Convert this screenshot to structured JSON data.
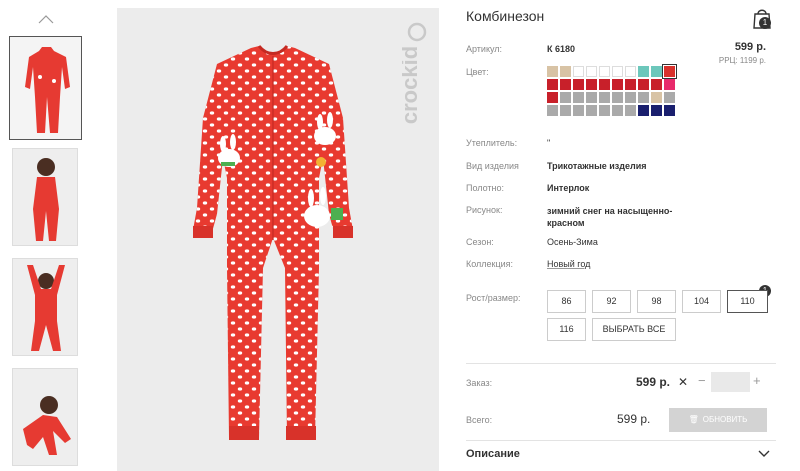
{
  "product": {
    "title": "Комбинезон",
    "cart_count": "1",
    "price": "599 р.",
    "rrp": "РРЦ: 1199 р."
  },
  "brand": "crockid",
  "fields": [
    {
      "label": "Артикул:",
      "value": "К 6180"
    },
    {
      "label": "Цвет:",
      "value": ""
    },
    {
      "label": "Утеплитель:",
      "value": "\""
    },
    {
      "label": "Вид изделия",
      "value": "Трикотажные изделия"
    },
    {
      "label": "Полотно:",
      "value": "Интерлок"
    },
    {
      "label": "Рисунок:",
      "value": "зимний снег на насыщенно-красном"
    },
    {
      "label": "Сезон:",
      "value": "Осень-Зима"
    },
    {
      "label": "Коллекция:",
      "value": "Новый год"
    },
    {
      "label": "Рост/размер:",
      "value": ""
    }
  ],
  "colors": [
    "#d8c3a5",
    "#d8c3a5",
    "#ffffff",
    "#ffffff",
    "#ffffff",
    "#ffffff",
    "#ffffff",
    "#6cc7bb",
    "#6cc7bb",
    "#d9302b",
    "#c8202a",
    "#c8202a",
    "#c8202a",
    "#c8202a",
    "#c8202a",
    "#c8202a",
    "#c8202a",
    "#c8202a",
    "#c8202a",
    "#e82a6b",
    "#c8202a",
    "#aaaaaa",
    "#aaaaaa",
    "#aaaaaa",
    "#aaaaaa",
    "#aaaaaa",
    "#aaaaaa",
    "#aaaaaa",
    "#d8c3a5",
    "#aaaaaa",
    "#aaaaaa",
    "#aaaaaa",
    "#aaaaaa",
    "#aaaaaa",
    "#aaaaaa",
    "#aaaaaa",
    "#aaaaaa",
    "#1a1f6e",
    "#1a1f6e",
    "#1a1f6e"
  ],
  "sizes": [
    "86",
    "92",
    "98",
    "104",
    "110",
    "116"
  ],
  "select_all": "ВЫБРАТЬ ВСЕ",
  "selected_size_count": "1",
  "order": {
    "label": "Заказ:",
    "price": "599 р.",
    "x": "✕",
    "minus": "−",
    "qty": "",
    "plus": "+"
  },
  "total": {
    "label": "Всего:",
    "price": "599 р.",
    "update_label": "ОБНОВИТЬ"
  },
  "description_label": "Описание"
}
